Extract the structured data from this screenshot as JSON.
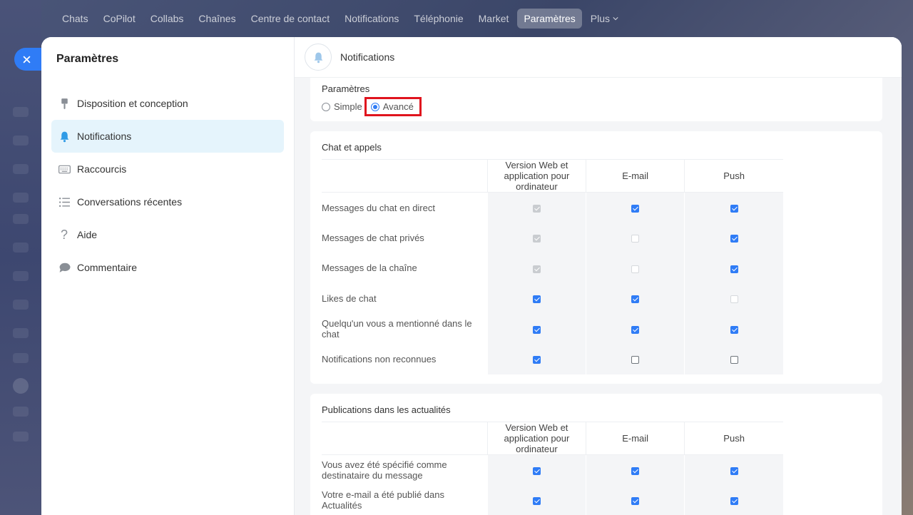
{
  "nav": {
    "items": [
      "Chats",
      "CoPilot",
      "Collabs",
      "Chaînes",
      "Centre de contact",
      "Notifications",
      "Téléphonie",
      "Market",
      "Paramètres",
      "Plus"
    ],
    "active_index": 8
  },
  "sidebar": {
    "title": "Paramètres",
    "items": [
      {
        "label": "Disposition et conception",
        "icon": "paintbrush-icon"
      },
      {
        "label": "Notifications",
        "icon": "bell-icon",
        "active": true
      },
      {
        "label": "Raccourcis",
        "icon": "keyboard-icon"
      },
      {
        "label": "Conversations récentes",
        "icon": "list-icon"
      },
      {
        "label": "Aide",
        "icon": "question-icon"
      },
      {
        "label": "Commentaire",
        "icon": "comment-icon"
      }
    ]
  },
  "header": {
    "title": "Notifications"
  },
  "mode": {
    "label": "Paramètres",
    "options": [
      "Simple",
      "Avancé"
    ],
    "selected": "Avancé"
  },
  "columns": [
    "Version Web et application pour ordinateur",
    "E-mail",
    "Push"
  ],
  "sections": [
    {
      "title": "Chat et appels",
      "rows": [
        {
          "label": "Messages du chat en direct",
          "states": [
            "dis-on",
            "on",
            "on"
          ]
        },
        {
          "label": "Messages de chat privés",
          "states": [
            "dis-on",
            "dis-off",
            "on"
          ]
        },
        {
          "label": "Messages de la chaîne",
          "states": [
            "dis-on",
            "dis-off",
            "on"
          ]
        },
        {
          "label": "Likes de chat",
          "states": [
            "on",
            "on",
            "dis-off"
          ]
        },
        {
          "label": "Quelqu'un vous a mentionné dans le chat",
          "states": [
            "on",
            "on",
            "on"
          ]
        },
        {
          "label": "Notifications non reconnues",
          "states": [
            "on",
            "off",
            "off"
          ]
        }
      ]
    },
    {
      "title": "Publications dans les actualités",
      "rows": [
        {
          "label": "Vous avez été spécifié comme destinataire du message",
          "states": [
            "on",
            "on",
            "on"
          ]
        },
        {
          "label": "Votre e-mail a été publié dans Actualités",
          "states": [
            "on",
            "on",
            "on"
          ]
        }
      ]
    }
  ],
  "colors": {
    "accent": "#2f7cf6",
    "highlight": "#e0141e",
    "active_sidebar": "#e5f4fc"
  }
}
